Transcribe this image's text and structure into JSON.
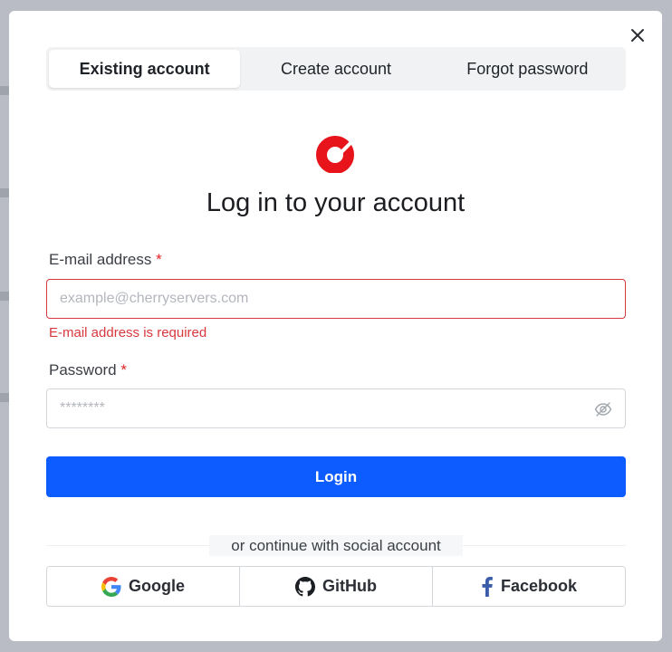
{
  "tabs": [
    {
      "label": "Existing account",
      "active": true
    },
    {
      "label": "Create account",
      "active": false
    },
    {
      "label": "Forgot password",
      "active": false
    }
  ],
  "brand": {
    "accent": "#e8141b"
  },
  "title": "Log in to your account",
  "email": {
    "label": "E-mail address",
    "required_mark": "*",
    "placeholder": "example@cherryservers.com",
    "value": "",
    "error": "E-mail address is required"
  },
  "password": {
    "label": "Password",
    "required_mark": "*",
    "placeholder": "********",
    "value": ""
  },
  "login_button": "Login",
  "divider_text": "or continue with social account",
  "social": [
    {
      "label": "Google",
      "icon": "google-icon"
    },
    {
      "label": "GitHub",
      "icon": "github-icon"
    },
    {
      "label": "Facebook",
      "icon": "facebook-icon"
    }
  ],
  "colors": {
    "primary": "#0d5cff",
    "error": "#d7383d"
  }
}
